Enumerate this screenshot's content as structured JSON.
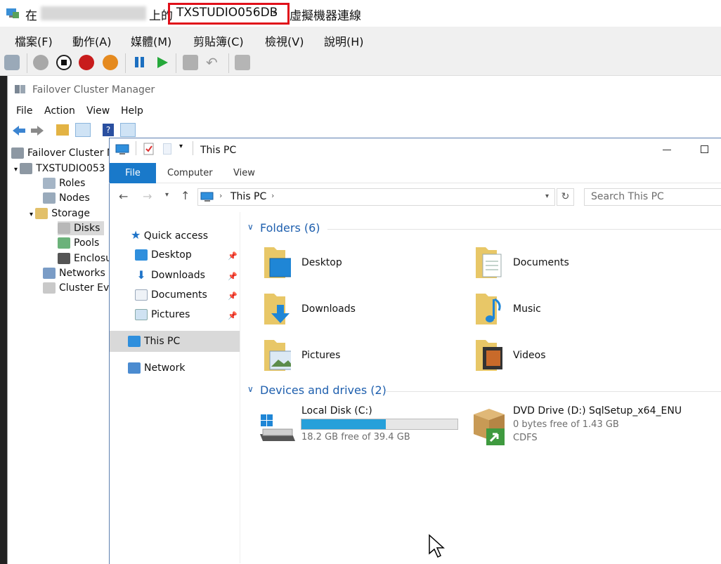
{
  "vm_window": {
    "title_prefix": "在",
    "title_mid": "上的",
    "vm_name": "TXSTUDIO056DB",
    "title_dash": "-",
    "title_suffix": "虛擬機器連線",
    "menu": [
      "檔案(F)",
      "動作(A)",
      "媒體(M)",
      "剪貼簿(C)",
      "檢視(V)",
      "說明(H)"
    ],
    "toolbar_icons": [
      "ctrl-alt-del-icon",
      "start-icon",
      "turn-off-icon",
      "shutdown-icon",
      "power-icon",
      "pause-icon",
      "resume-icon",
      "checkpoint-icon",
      "revert-icon",
      "enhanced-session-icon"
    ]
  },
  "fcm": {
    "title": "Failover Cluster Manager",
    "menu": [
      "File",
      "Action",
      "View",
      "Help"
    ],
    "tree": {
      "root": "Failover Cluster M",
      "cluster": "TXSTUDIO053",
      "roles": "Roles",
      "nodes": "Nodes",
      "storage": "Storage",
      "disks": "Disks",
      "pools": "Pools",
      "enclosures": "Enclosu",
      "networks": "Networks",
      "cluster_events": "Cluster Eve"
    }
  },
  "explorer": {
    "title": "This PC",
    "ribbon_tabs": [
      "File",
      "Computer",
      "View"
    ],
    "breadcrumb": "This PC",
    "search_placeholder": "Search This PC",
    "nav": {
      "quick_access": "Quick access",
      "pinned": [
        "Desktop",
        "Downloads",
        "Documents",
        "Pictures"
      ],
      "this_pc": "This PC",
      "network": "Network"
    },
    "folders_header": "Folders (6)",
    "folders": [
      "Desktop",
      "Documents",
      "Downloads",
      "Music",
      "Pictures",
      "Videos"
    ],
    "devices_header": "Devices and drives (2)",
    "drives": [
      {
        "name": "Local Disk (C:)",
        "free": "18.2 GB free of 39.4 GB",
        "used_fraction": 0.54
      },
      {
        "name": "DVD Drive (D:) SqlSetup_x64_ENU",
        "free": "0 bytes free of 1.43 GB",
        "fs": "CDFS"
      }
    ]
  },
  "colors": {
    "accent": "#1979ca",
    "highlight_red": "#e0101a",
    "group_header": "#1e5fae",
    "drive_bar": "#26a0da"
  }
}
